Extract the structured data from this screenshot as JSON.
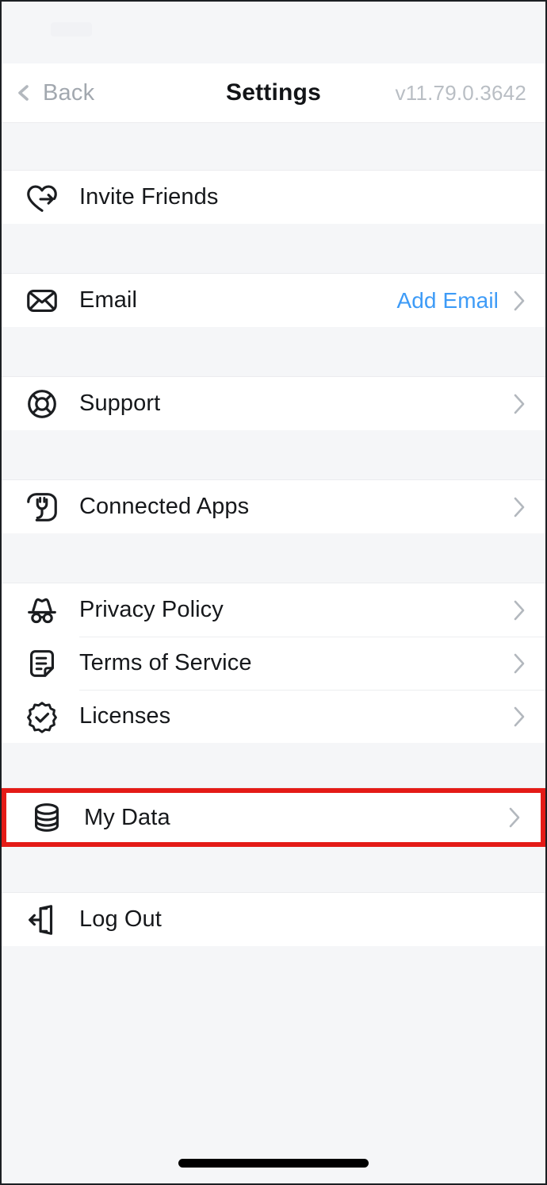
{
  "app": {
    "screen_title": "Settings",
    "version": "v11.79.0.3642"
  },
  "nav": {
    "back_label": "Back",
    "back_icon": "chevron-left-icon"
  },
  "sections": [
    {
      "id": "invite",
      "rows": [
        {
          "id": "invite-friends",
          "label": "Invite Friends",
          "icon": "heart-share-icon",
          "chevron": false,
          "action": null
        }
      ]
    },
    {
      "id": "email",
      "rows": [
        {
          "id": "email",
          "label": "Email",
          "icon": "envelope-icon",
          "chevron": true,
          "action": "Add Email"
        }
      ]
    },
    {
      "id": "support",
      "rows": [
        {
          "id": "support",
          "label": "Support",
          "icon": "lifebuoy-icon",
          "chevron": true,
          "action": null
        }
      ]
    },
    {
      "id": "connected-apps",
      "rows": [
        {
          "id": "connected-apps",
          "label": "Connected Apps",
          "icon": "plug-icon",
          "chevron": true,
          "action": null
        }
      ]
    },
    {
      "id": "legal",
      "rows": [
        {
          "id": "privacy-policy",
          "label": "Privacy Policy",
          "icon": "incognito-icon",
          "chevron": true,
          "action": null
        },
        {
          "id": "terms-of-service",
          "label": "Terms of Service",
          "icon": "document-icon",
          "chevron": true,
          "action": null
        },
        {
          "id": "licenses",
          "label": "Licenses",
          "icon": "badge-check-icon",
          "chevron": true,
          "action": null
        }
      ]
    },
    {
      "id": "my-data",
      "highlighted": true,
      "rows": [
        {
          "id": "my-data",
          "label": "My Data",
          "icon": "database-icon",
          "chevron": true,
          "action": null
        }
      ]
    },
    {
      "id": "logout",
      "rows": [
        {
          "id": "log-out",
          "label": "Log Out",
          "icon": "logout-door-icon",
          "chevron": false,
          "action": null
        }
      ]
    }
  ],
  "colors": {
    "accent_link": "#3d9bf7",
    "highlight_border": "#e41b17",
    "page_background": "#f5f6f8",
    "row_background": "#ffffff",
    "label_text": "#16181b",
    "muted_text": "#b9bec4"
  }
}
